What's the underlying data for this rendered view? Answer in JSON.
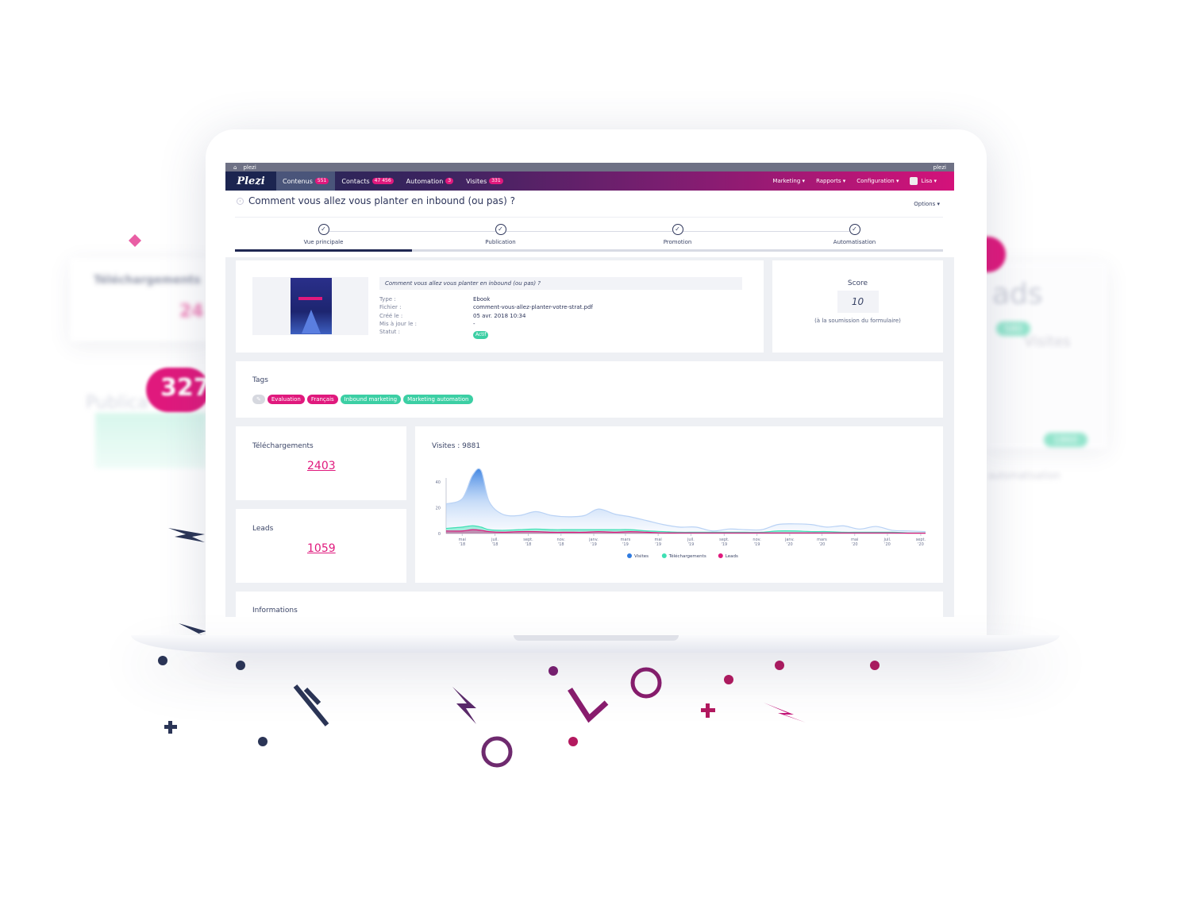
{
  "decor": {
    "left_card_title": "Téléchargements",
    "left_card_value": "24",
    "left_bubble": "327",
    "left_label": "Publica",
    "right_word": "ads",
    "right_label": "Visites",
    "right_badge_1": "580",
    "right_badge_2": "1860",
    "right_small": "automatisation"
  },
  "topbar": {
    "site": "plezi",
    "account": "plezi"
  },
  "nav": {
    "logo": "Plezi",
    "items": [
      {
        "label": "Contenus",
        "count": "551"
      },
      {
        "label": "Contacts",
        "count": "47 456"
      },
      {
        "label": "Automation",
        "count": "3"
      },
      {
        "label": "Visites",
        "count": "331"
      }
    ],
    "right": [
      "Marketing ▾",
      "Rapports ▾",
      "Configuration ▾",
      "Lisa ▾"
    ]
  },
  "page": {
    "title": "Comment vous allez vous planter en inbound (ou pas) ?",
    "options": "Options ▾"
  },
  "steps": [
    {
      "label": "Vue principale",
      "active": true
    },
    {
      "label": "Publication"
    },
    {
      "label": "Promotion"
    },
    {
      "label": "Automatisation"
    }
  ],
  "content": {
    "heading": "Comment vous allez vous planter en inbound (ou pas) ?",
    "fields": [
      {
        "label": "Type :",
        "value": "Ebook"
      },
      {
        "label": "Fichier :",
        "value": "comment-vous-allez-planter-votre-strat.pdf"
      },
      {
        "label": "Créé le :",
        "value": "05 avr. 2018 10:34"
      },
      {
        "label": "Mis à jour le :",
        "value": "-"
      },
      {
        "label": "Statut :",
        "value": "Actif"
      }
    ]
  },
  "score": {
    "title": "Score",
    "value": "10",
    "note": "(à la soumission du formulaire)"
  },
  "tags": {
    "title": "Tags",
    "items": [
      {
        "label": "Evaluation",
        "color": "#e0197d"
      },
      {
        "label": "Français",
        "color": "#e0197d"
      },
      {
        "label": "Inbound marketing",
        "color": "#3ccfa4"
      },
      {
        "label": "Marketing automation",
        "color": "#3ccfa4"
      }
    ]
  },
  "stats": {
    "downloads_label": "Téléchargements",
    "downloads": "2403",
    "leads_label": "Leads",
    "leads": "1059"
  },
  "informations": "Informations",
  "chart_data": {
    "type": "area",
    "title": "Visites : 9881",
    "xlim": [
      "2018-04-01",
      "2020-09-10"
    ],
    "ylim": [
      0,
      50
    ],
    "yticks": [
      0,
      20,
      40
    ],
    "xticks": [
      [
        "2018-05-01",
        "mai",
        "'18"
      ],
      [
        "2018-07-01",
        "juil.",
        "'18"
      ],
      [
        "2018-09-01",
        "sept.",
        "'18"
      ],
      [
        "2018-11-01",
        "nov.",
        "'18"
      ],
      [
        "2019-01-01",
        "janv.",
        "'19"
      ],
      [
        "2019-03-01",
        "mars",
        "'19"
      ],
      [
        "2019-05-01",
        "mai",
        "'19"
      ],
      [
        "2019-07-01",
        "juil.",
        "'19"
      ],
      [
        "2019-09-01",
        "sept.",
        "'19"
      ],
      [
        "2019-11-01",
        "nov.",
        "'19"
      ],
      [
        "2020-01-01",
        "janv.",
        "'20"
      ],
      [
        "2020-03-01",
        "mars",
        "'20"
      ],
      [
        "2020-05-01",
        "mai",
        "'20"
      ],
      [
        "2020-07-01",
        "juil.",
        "'20"
      ],
      [
        "2020-09-01",
        "sept.",
        "'20"
      ]
    ],
    "x": [
      "2018-04-01",
      "2018-05-01",
      "2018-05-20",
      "2018-06-05",
      "2018-06-20",
      "2018-07-15",
      "2018-08-15",
      "2018-09-15",
      "2018-10-15",
      "2018-11-15",
      "2018-12-15",
      "2019-01-10",
      "2019-02-10",
      "2019-03-10",
      "2019-04-10",
      "2019-05-10",
      "2019-06-10",
      "2019-07-10",
      "2019-08-10",
      "2019-09-10",
      "2019-10-10",
      "2019-11-10",
      "2019-12-10",
      "2020-01-10",
      "2020-02-10",
      "2020-03-10",
      "2020-04-10",
      "2020-05-10",
      "2020-06-10",
      "2020-07-10",
      "2020-08-10",
      "2020-09-10"
    ],
    "series": [
      {
        "name": "Visites",
        "color": "#2f7be0",
        "values": [
          23,
          27,
          45,
          49,
          25,
          15,
          14,
          17,
          14,
          13,
          14,
          19,
          15,
          13,
          10,
          7,
          5,
          5,
          2,
          3.5,
          3,
          3,
          7,
          7.5,
          7,
          5,
          6,
          3.5,
          5.5,
          2.5,
          2,
          1.5
        ]
      },
      {
        "name": "Téléchargements",
        "color": "#3ee0b4",
        "values": [
          4,
          5,
          6,
          5,
          3,
          2.5,
          3,
          3.5,
          3,
          3,
          3,
          3,
          3,
          3,
          2,
          1.5,
          1,
          1,
          1,
          1,
          1,
          1,
          2,
          2,
          1.5,
          1.5,
          1,
          1,
          1,
          1,
          0.5,
          0.5
        ]
      },
      {
        "name": "Leads",
        "color": "#e0197d",
        "values": [
          2,
          2,
          3,
          2.5,
          1.5,
          1,
          1.5,
          1.5,
          1,
          1,
          1,
          1.5,
          1,
          1.5,
          1,
          0.5,
          0.5,
          0.5,
          0.5,
          0.5,
          0.5,
          0.5,
          0.5,
          0.5,
          0.5,
          0.5,
          0.5,
          0.5,
          0.5,
          0.5,
          0.3,
          0.3
        ]
      }
    ],
    "legend": "bottom"
  }
}
